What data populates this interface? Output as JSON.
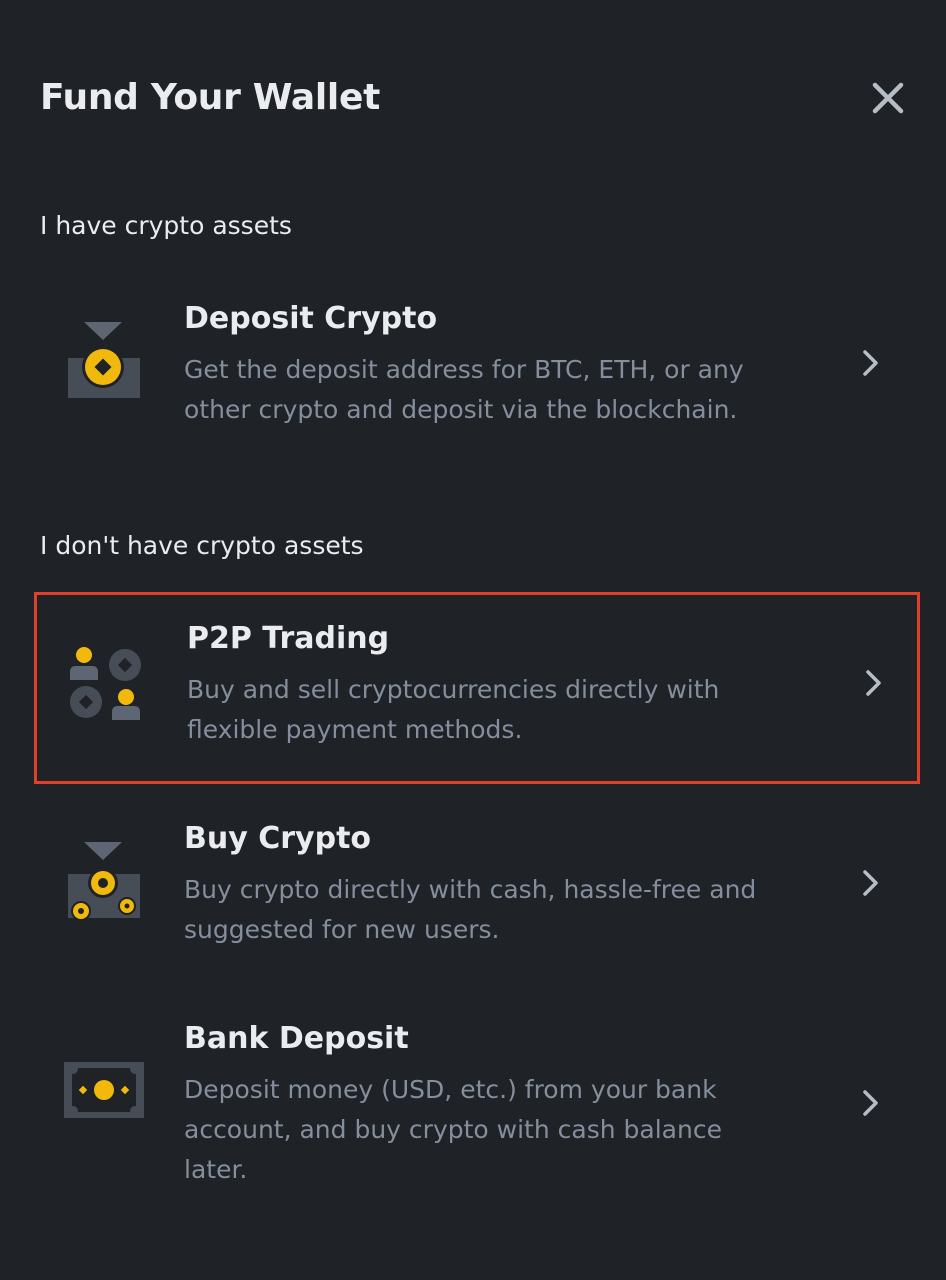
{
  "header": {
    "title": "Fund Your Wallet",
    "close_icon": "close-icon"
  },
  "sections": [
    {
      "label": "I have crypto assets",
      "options": [
        {
          "title": "Deposit Crypto",
          "description": "Get the deposit address for BTC, ETH, or any other crypto and deposit via the blockchain.",
          "icon": "deposit-crypto-icon"
        }
      ]
    },
    {
      "label": "I don't have crypto assets",
      "options": [
        {
          "title": "P2P Trading",
          "description": "Buy and sell cryptocurrencies directly with flexible payment methods.",
          "icon": "p2p-trading-icon",
          "highlighted": true
        },
        {
          "title": "Buy Crypto",
          "description": "Buy crypto directly with cash, hassle-free and suggested for new users.",
          "icon": "buy-crypto-icon"
        },
        {
          "title": "Bank Deposit",
          "description": "Deposit money (USD, etc.) from your bank account, and buy crypto with cash balance later.",
          "icon": "bank-deposit-icon"
        }
      ]
    }
  ],
  "colors": {
    "background": "#1f2227",
    "accent": "#f0b90b",
    "icon_gray": "#474d57",
    "text_primary": "#eaecef",
    "text_secondary": "#848e9c",
    "highlight_border": "#e0402b"
  }
}
